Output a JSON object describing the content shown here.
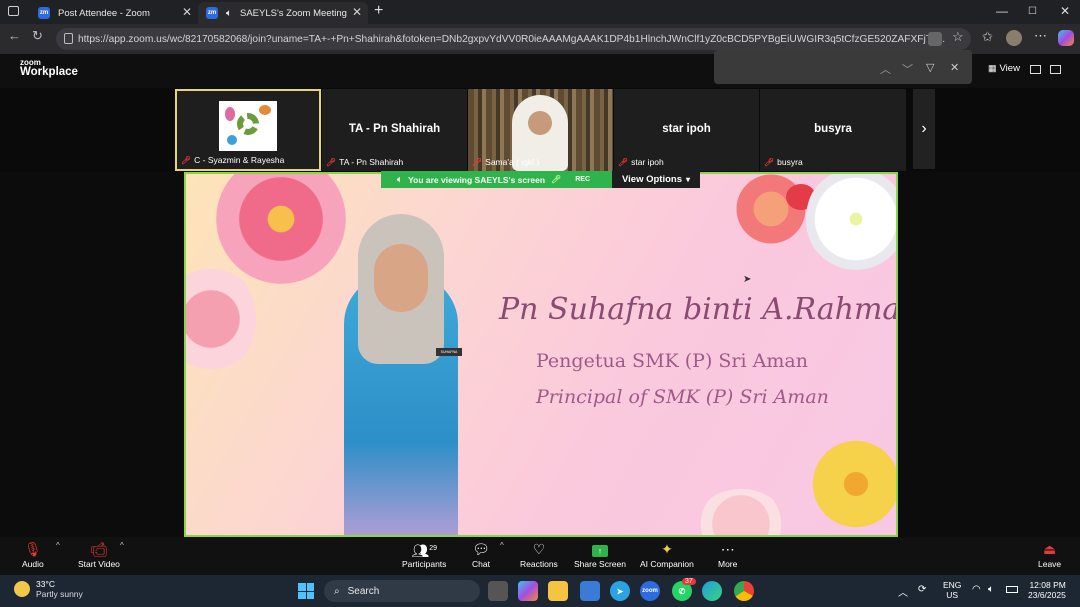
{
  "browser": {
    "tabs": [
      {
        "title": "Post Attendee - Zoom"
      },
      {
        "title": "SAEYLS's Zoom Meeting"
      }
    ],
    "url": "https://app.zoom.us/wc/82170582068/join?uname=TA+-+Pn+Shahirah&fotoken=DNb2gxpvYdVV0R0ieAAAMgAAAK1DP4b1HlnchJWnClf1yZ0cBCD5PYBgEiUWGIR3q5tCfzGE520ZAFXFjTo..."
  },
  "zoom": {
    "logo_small": "zoom",
    "logo_big": "Workplace",
    "view_label": "View",
    "participants": [
      {
        "tile_name": "",
        "caption": "C - Syazmin & Rayesha"
      },
      {
        "tile_name": "TA - Pn Shahirah",
        "caption": "TA - Pn Shahirah"
      },
      {
        "tile_name": "",
        "caption": "Sama'a ( iqkl )"
      },
      {
        "tile_name": "star ipoh",
        "caption": "star ipoh"
      },
      {
        "tile_name": "busyra",
        "caption": "busyra"
      }
    ],
    "viewing_banner": "You are viewing  SAEYLS's screen",
    "rec_label": "REC",
    "view_options": "View Options",
    "slide": {
      "name": "Pn Suhafna binti A.Rahman",
      "line1": "Pengetua SMK (P) Sri Aman",
      "line2": "Principal of SMK (P) Sri Aman",
      "badge": "SUHAFNA"
    },
    "toolbar": {
      "audio": "Audio",
      "start_video": "Start Video",
      "participants": "Participants",
      "participants_count": "29",
      "chat": "Chat",
      "reactions": "Reactions",
      "share_screen": "Share Screen",
      "ai_companion": "AI Companion",
      "more": "More",
      "leave": "Leave"
    }
  },
  "taskbar": {
    "weather_temp": "33°C",
    "weather_desc": "Partly sunny",
    "search": "Search",
    "whatsapp_badge": "37",
    "lang1": "ENG",
    "lang2": "US",
    "time": "12:08 PM",
    "date": "23/6/2025"
  }
}
